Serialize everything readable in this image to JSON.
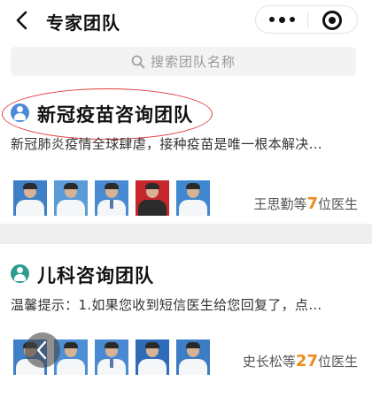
{
  "header": {
    "title": "专家团队",
    "back_icon": "back-arrow-icon",
    "more_icon": "more-dots-icon",
    "close_icon": "close-circle-icon"
  },
  "search": {
    "placeholder": "搜索团队名称",
    "icon": "search-icon"
  },
  "teams": [
    {
      "name": "新冠疫苗咨询团队",
      "description": "新冠肺炎疫情全球肆虐，接种疫苗是唯一根本解决…",
      "count_prefix": "王思勤等",
      "count_value": "7",
      "count_suffix": "位医生",
      "icon_color": "#4a8ad8",
      "highlighted": true
    },
    {
      "name": "儿科咨询团队",
      "description": "温馨提示：1.如果您收到短信医生给您回复了，点…",
      "count_prefix": "史长松等",
      "count_value": "27",
      "count_suffix": "位医生",
      "icon_color": "#2a9d8f",
      "highlighted": false
    }
  ],
  "colors": {
    "accent_count": "#f08a1c",
    "annotation_ellipse": "#e23b3b",
    "background": "#efefef"
  }
}
